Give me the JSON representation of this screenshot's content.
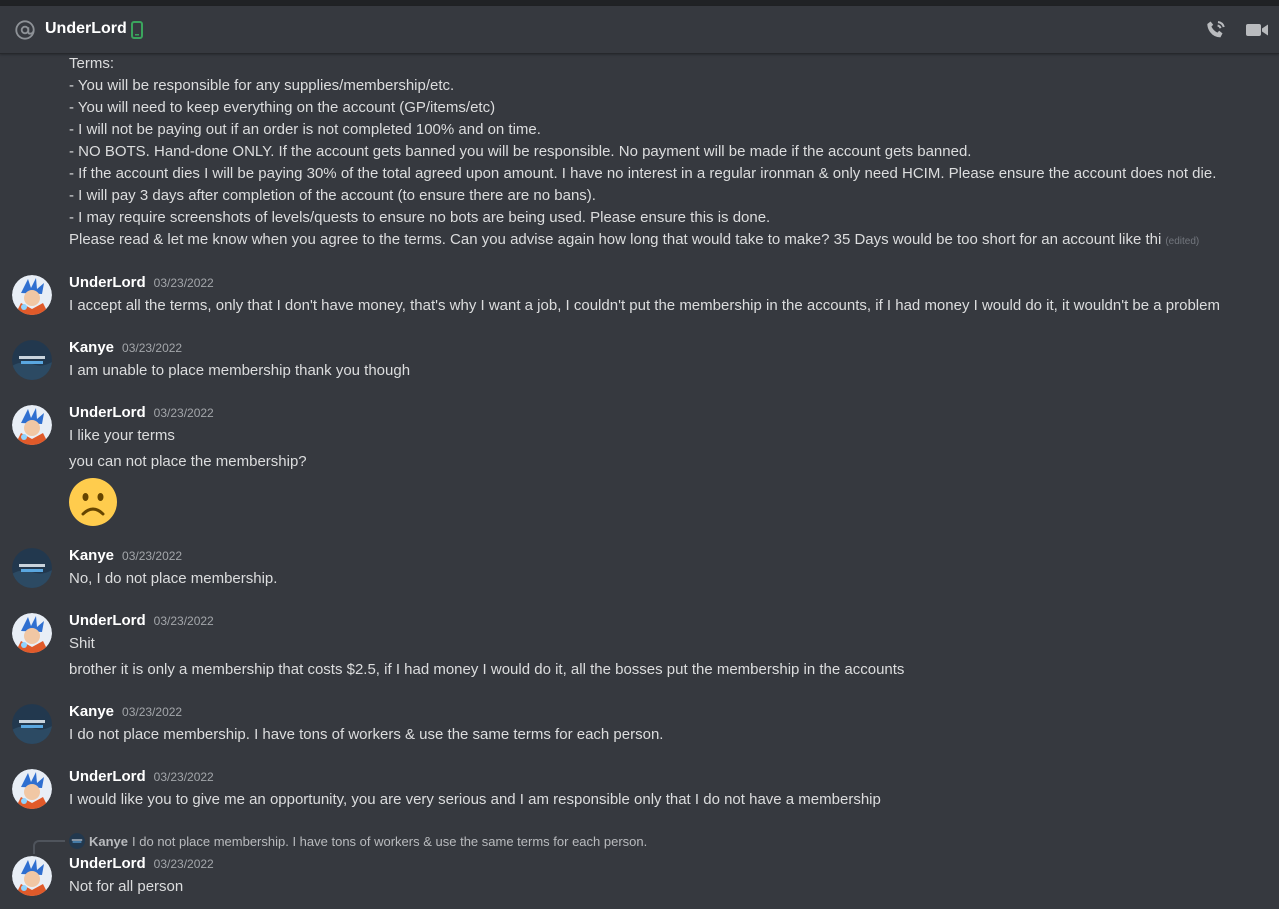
{
  "header": {
    "title": "UnderLord"
  },
  "intro_lines": [
    "Terms:",
    "- You will be responsible for any supplies/membership/etc.",
    "- You will need to keep everything on the account (GP/items/etc)",
    "- I will not be paying out if an order is not completed 100% and on time.",
    "- NO BOTS. Hand-done ONLY. If the account gets banned you will be responsible. No payment will be made if the account gets banned.",
    "- If the account dies I will be paying 30% of the total agreed upon amount. I have no interest in a regular ironman & only need HCIM. Please ensure the account does not die.",
    "- I will pay 3 days after completion of the account (to ensure there are no bans).",
    "- I may require screenshots of levels/quests to ensure no bots are being used. Please ensure this is done.",
    "Please read & let me know when you agree to the terms. Can you advise again how long that would take to make? 35 Days would be too short for an account like thi"
  ],
  "edited_label": "(edited)",
  "messages": [
    {
      "author": "UnderLord",
      "time": "03/23/2022",
      "lines": [
        "I accept all the terms, only that I don't have money, that's why I want a job, I couldn't put the membership in the accounts, if I had money I would do it, it wouldn't be a problem"
      ]
    },
    {
      "author": "Kanye",
      "time": "03/23/2022",
      "lines": [
        "I am unable to place membership thank you though"
      ]
    },
    {
      "author": "UnderLord",
      "time": "03/23/2022",
      "lines": [
        "I like your terms",
        "you can not place the membership?"
      ]
    },
    {
      "author": "Kanye",
      "time": "03/23/2022",
      "lines": [
        "No, I do not place membership."
      ]
    },
    {
      "author": "UnderLord",
      "time": "03/23/2022",
      "lines": [
        "Shit",
        "brother it is only a membership that costs $2.5, if I had money I would do it, all the bosses put the membership in the accounts"
      ]
    },
    {
      "author": "Kanye",
      "time": "03/23/2022",
      "lines": [
        "I do not place membership. I have tons of workers & use the same terms for each person."
      ]
    },
    {
      "author": "UnderLord",
      "time": "03/23/2022",
      "lines": [
        "I would like you to give me an opportunity, you are very serious and I am responsible only that I do not have a membership"
      ]
    },
    {
      "author": "UnderLord",
      "time": "03/23/2022",
      "lines": [
        "Not for all person"
      ]
    }
  ],
  "reply": {
    "author": "Kanye",
    "text": "I do not place membership. I have tons of workers & use the same terms for each person."
  },
  "colors": {
    "background": "#36393f",
    "text": "#dcddde",
    "online_green": "#3ba55d",
    "emoji_yellow": "#ffcc4d"
  },
  "icons": [
    "at-icon",
    "mobile-phone-icon",
    "voice-call-icon",
    "video-call-icon",
    "frowning-face-emoji"
  ]
}
